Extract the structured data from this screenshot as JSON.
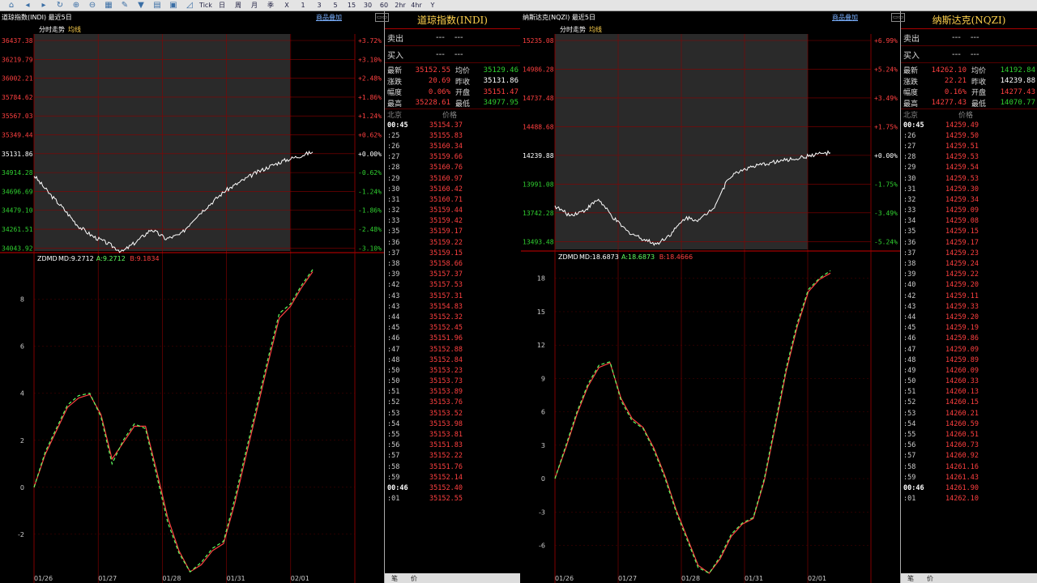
{
  "toolbar": {
    "icons": [
      "home-icon",
      "back-icon",
      "forward-icon",
      "refresh-icon",
      "zoom-in-icon",
      "zoom-out-icon",
      "chart-icon",
      "edit-icon",
      "funnel-icon",
      "grid-icon",
      "window-icon",
      "line-chart-icon"
    ],
    "periods": [
      "Tick",
      "日",
      "周",
      "月",
      "季",
      "X",
      "1",
      "3",
      "5",
      "15",
      "30",
      "60",
      "2hr",
      "4hr",
      "Y"
    ]
  },
  "panels": [
    {
      "id": "dji",
      "title": "道琼指数(INDI) 最近5日",
      "overlay_label": "商品叠加",
      "mode_label": "分时走势",
      "avg_label": "均线",
      "side_title": "道琼指数(INDI)",
      "ask_label": "卖出",
      "ask_price": "---",
      "ask_vol": "---",
      "bid_label": "买入",
      "bid_price": "---",
      "bid_vol": "---",
      "quote": [
        {
          "l1": "最新",
          "v1": "35152.55",
          "c1": "red",
          "l2": "均价",
          "v2": "35129.46",
          "c2": "green"
        },
        {
          "l1": "涨跌",
          "v1": "20.69",
          "c1": "red",
          "l2": "昨收",
          "v2": "35131.86",
          "c2": "white"
        },
        {
          "l1": "幅度",
          "v1": "0.06%",
          "c1": "red",
          "l2": "开盘",
          "v2": "35151.47",
          "c2": "red"
        },
        {
          "l1": "最高",
          "v1": "35228.61",
          "c1": "red",
          "l2": "最低",
          "v2": "34977.95",
          "c2": "green"
        }
      ],
      "tick_head": [
        "北京",
        "价格"
      ],
      "ticks": [
        [
          "00:45",
          "35154.37",
          true
        ],
        [
          ":25",
          "35155.83",
          false
        ],
        [
          ":26",
          "35160.34",
          false
        ],
        [
          ":27",
          "35159.66",
          false
        ],
        [
          ":28",
          "35160.76",
          false
        ],
        [
          ":29",
          "35160.97",
          false
        ],
        [
          ":30",
          "35160.42",
          false
        ],
        [
          ":31",
          "35160.71",
          false
        ],
        [
          ":32",
          "35159.44",
          false
        ],
        [
          ":33",
          "35159.42",
          false
        ],
        [
          ":35",
          "35159.17",
          false
        ],
        [
          ":36",
          "35159.22",
          false
        ],
        [
          ":37",
          "35159.15",
          false
        ],
        [
          ":38",
          "35158.66",
          false
        ],
        [
          ":39",
          "35157.37",
          false
        ],
        [
          ":42",
          "35157.53",
          false
        ],
        [
          ":43",
          "35157.31",
          false
        ],
        [
          ":43",
          "35154.83",
          false
        ],
        [
          ":44",
          "35152.32",
          false
        ],
        [
          ":45",
          "35152.45",
          false
        ],
        [
          ":46",
          "35151.96",
          false
        ],
        [
          ":47",
          "35152.88",
          false
        ],
        [
          ":48",
          "35152.84",
          false
        ],
        [
          ":50",
          "35153.23",
          false
        ],
        [
          ":50",
          "35153.73",
          false
        ],
        [
          ":51",
          "35153.89",
          false
        ],
        [
          ":52",
          "35153.76",
          false
        ],
        [
          ":53",
          "35153.52",
          false
        ],
        [
          ":54",
          "35153.98",
          false
        ],
        [
          ":55",
          "35153.81",
          false
        ],
        [
          ":56",
          "35151.83",
          false
        ],
        [
          ":57",
          "35152.22",
          false
        ],
        [
          ":58",
          "35151.76",
          false
        ],
        [
          ":59",
          "35152.14",
          false
        ],
        [
          "00:46",
          "35152.40",
          true
        ],
        [
          ":01",
          "35152.55",
          false
        ]
      ],
      "price_ticks": [
        "36437.38",
        "36219.79",
        "36002.21",
        "35784.62",
        "35567.03",
        "35349.44",
        "35131.86",
        "34914.28",
        "34696.69",
        "34479.10",
        "34261.51",
        "34043.92"
      ],
      "pct_ticks": [
        "+3.72%",
        "+3.10%",
        "+2.48%",
        "+1.86%",
        "+1.24%",
        "+0.62%",
        "+0.00%",
        "-0.62%",
        "-1.24%",
        "-1.86%",
        "-2.48%",
        "-3.10%"
      ],
      "ind_label": "ZDMD",
      "ind_md": "MD:9.2712",
      "ind_a": "A:9.2712",
      "ind_b": "B:9.1834",
      "ind_ticks": [
        "8",
        "6",
        "4",
        "2",
        "0",
        "-2"
      ],
      "dates": [
        "01/26",
        "01/27",
        "01/28",
        "01/31",
        "02/01"
      ],
      "bottom_tabs": [
        "笔",
        "价"
      ]
    },
    {
      "id": "nq",
      "title": "纳斯达克(NQZI) 最近5日",
      "overlay_label": "商品叠加",
      "mode_label": "分时走势",
      "avg_label": "均线",
      "side_title": "纳斯达克(NQZI)",
      "ask_label": "卖出",
      "ask_price": "---",
      "ask_vol": "---",
      "bid_label": "买入",
      "bid_price": "---",
      "bid_vol": "---",
      "quote": [
        {
          "l1": "最新",
          "v1": "14262.10",
          "c1": "red",
          "l2": "均价",
          "v2": "14192.84",
          "c2": "green"
        },
        {
          "l1": "涨跌",
          "v1": "22.21",
          "c1": "red",
          "l2": "昨收",
          "v2": "14239.88",
          "c2": "white"
        },
        {
          "l1": "幅度",
          "v1": "0.16%",
          "c1": "red",
          "l2": "开盘",
          "v2": "14277.43",
          "c2": "red"
        },
        {
          "l1": "最高",
          "v1": "14277.43",
          "c1": "red",
          "l2": "最低",
          "v2": "14070.77",
          "c2": "green"
        }
      ],
      "tick_head": [
        "北京",
        "价格"
      ],
      "ticks": [
        [
          "00:45",
          "14259.49",
          true
        ],
        [
          ":26",
          "14259.50",
          false
        ],
        [
          ":27",
          "14259.51",
          false
        ],
        [
          ":28",
          "14259.53",
          false
        ],
        [
          ":29",
          "14259.54",
          false
        ],
        [
          ":30",
          "14259.53",
          false
        ],
        [
          ":31",
          "14259.30",
          false
        ],
        [
          ":32",
          "14259.34",
          false
        ],
        [
          ":33",
          "14259.09",
          false
        ],
        [
          ":34",
          "14259.08",
          false
        ],
        [
          ":35",
          "14259.15",
          false
        ],
        [
          ":36",
          "14259.17",
          false
        ],
        [
          ":37",
          "14259.23",
          false
        ],
        [
          ":38",
          "14259.24",
          false
        ],
        [
          ":39",
          "14259.22",
          false
        ],
        [
          ":40",
          "14259.20",
          false
        ],
        [
          ":42",
          "14259.11",
          false
        ],
        [
          ":43",
          "14259.33",
          false
        ],
        [
          ":44",
          "14259.20",
          false
        ],
        [
          ":45",
          "14259.19",
          false
        ],
        [
          ":46",
          "14259.86",
          false
        ],
        [
          ":47",
          "14259.09",
          false
        ],
        [
          ":48",
          "14259.89",
          false
        ],
        [
          ":49",
          "14260.09",
          false
        ],
        [
          ":50",
          "14260.33",
          false
        ],
        [
          ":51",
          "14260.13",
          false
        ],
        [
          ":52",
          "14260.15",
          false
        ],
        [
          ":53",
          "14260.21",
          false
        ],
        [
          ":54",
          "14260.59",
          false
        ],
        [
          ":55",
          "14260.51",
          false
        ],
        [
          ":56",
          "14260.73",
          false
        ],
        [
          ":57",
          "14260.92",
          false
        ],
        [
          ":58",
          "14261.16",
          false
        ],
        [
          ":59",
          "14261.43",
          false
        ],
        [
          "00:46",
          "14261.90",
          true
        ],
        [
          ":01",
          "14262.10",
          false
        ]
      ],
      "price_ticks": [
        "15235.08",
        "14986.28",
        "14737.48",
        "14488.68",
        "14239.88",
        "13991.08",
        "13742.28",
        "13493.48"
      ],
      "pct_ticks": [
        "+6.99%",
        "+5.24%",
        "+3.49%",
        "+1.75%",
        "+0.00%",
        "-1.75%",
        "-3.49%",
        "-5.24%"
      ],
      "ind_label": "ZDMD",
      "ind_md": "MD:18.6873",
      "ind_a": "A:18.6873",
      "ind_b": "B:18.4666",
      "ind_ticks": [
        "18",
        "15",
        "12",
        "9",
        "6",
        "3",
        "0",
        "-3",
        "-6"
      ],
      "dates": [
        "01/26",
        "01/27",
        "01/28",
        "01/31",
        "02/01"
      ],
      "bottom_tabs": [
        "笔",
        "价"
      ]
    }
  ],
  "colors": {
    "up": "#ff4040",
    "down": "#30d030",
    "grid": "#8b0000",
    "shade": "#2a2a2a",
    "price_line": "#ffffff",
    "ind_a": "#60ff60",
    "ind_b": "#ff4040"
  },
  "chart_data": [
    {
      "type": "line",
      "title": "道琼指数(INDI) 最近5日",
      "x": [
        "01/26",
        "01/27",
        "01/28",
        "01/31",
        "02/01"
      ],
      "series": [
        {
          "values": [
            34880,
            34680,
            34500,
            34300,
            34180,
            34100,
            34000,
            34120,
            34260,
            34150,
            34200,
            34400,
            34550,
            34700,
            34800,
            34900,
            34980,
            35050,
            35100,
            35152
          ]
        }
      ],
      "ylim": [
        34043.92,
        36437.38
      ]
    },
    {
      "type": "line",
      "title": "ZDMD",
      "x": [
        "01/26",
        "01/27",
        "01/28",
        "01/31",
        "02/01"
      ],
      "series": [
        {
          "name": "A",
          "values": [
            0,
            1.5,
            2.5,
            3.5,
            3.9,
            4.0,
            3.0,
            1.0,
            2.0,
            2.7,
            2.5,
            0.5,
            -1.5,
            -2.8,
            -3.6,
            -3.2,
            -2.6,
            -2.3,
            -0.5,
            1.5,
            3.5,
            5.5,
            7.4,
            7.8,
            8.6,
            9.27
          ]
        },
        {
          "name": "B",
          "values": [
            0,
            1.4,
            2.4,
            3.4,
            3.8,
            3.95,
            3.1,
            1.2,
            1.9,
            2.6,
            2.6,
            0.7,
            -1.3,
            -2.7,
            -3.6,
            -3.3,
            -2.7,
            -2.4,
            -0.7,
            1.3,
            3.3,
            5.3,
            7.2,
            7.7,
            8.5,
            9.18
          ]
        }
      ],
      "ylim": [
        -3.8,
        9.3
      ]
    },
    {
      "type": "line",
      "title": "纳斯达克(NQZI) 最近5日",
      "x": [
        "01/26",
        "01/27",
        "01/28",
        "01/31",
        "02/01"
      ],
      "series": [
        {
          "values": [
            13800,
            13720,
            13760,
            13860,
            13700,
            13580,
            13520,
            13470,
            13560,
            13700,
            13680,
            13800,
            14050,
            14120,
            14150,
            14180,
            14200,
            14220,
            14250,
            14262
          ]
        }
      ],
      "ylim": [
        13493.48,
        15235.08
      ]
    },
    {
      "type": "line",
      "title": "ZDMD",
      "x": [
        "01/26",
        "01/27",
        "01/28",
        "01/31",
        "02/01"
      ],
      "series": [
        {
          "name": "A",
          "values": [
            0,
            3,
            6,
            8.5,
            10.2,
            10.5,
            7,
            5.2,
            4.5,
            2.5,
            0,
            -3,
            -5.5,
            -8,
            -8.5,
            -7,
            -5,
            -4,
            -3.5,
            0,
            5,
            10,
            14,
            17,
            18,
            18.69
          ]
        },
        {
          "name": "B",
          "values": [
            0,
            2.8,
            5.8,
            8.3,
            10.0,
            10.4,
            7.2,
            5.4,
            4.6,
            2.7,
            0.2,
            -2.8,
            -5.3,
            -7.8,
            -8.5,
            -7.2,
            -5.2,
            -4.1,
            -3.6,
            -0.2,
            4.7,
            9.7,
            13.7,
            16.8,
            17.9,
            18.47
          ]
        }
      ],
      "ylim": [
        -8.8,
        19
      ]
    }
  ]
}
